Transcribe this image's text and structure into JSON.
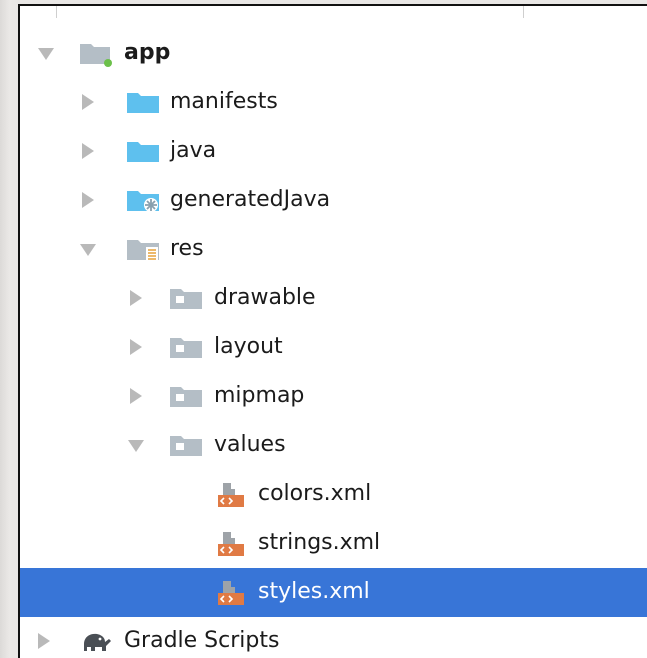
{
  "tree": {
    "app": {
      "label": "app",
      "expanded": true,
      "icon": "module-folder-icon"
    },
    "manifests": {
      "label": "manifests",
      "expanded": false,
      "icon": "folder-icon"
    },
    "java": {
      "label": "java",
      "expanded": false,
      "icon": "folder-icon"
    },
    "generatedJava": {
      "label": "generatedJava",
      "expanded": false,
      "icon": "generated-folder-icon"
    },
    "res": {
      "label": "res",
      "expanded": true,
      "icon": "resources-folder-icon"
    },
    "drawable": {
      "label": "drawable",
      "expanded": false,
      "icon": "resource-subfolder-icon"
    },
    "layout": {
      "label": "layout",
      "expanded": false,
      "icon": "resource-subfolder-icon"
    },
    "mipmap": {
      "label": "mipmap",
      "expanded": false,
      "icon": "resource-subfolder-icon"
    },
    "values": {
      "label": "values",
      "expanded": true,
      "icon": "resource-subfolder-icon"
    },
    "colors": {
      "label": "colors.xml",
      "icon": "xml-file-icon"
    },
    "strings": {
      "label": "strings.xml",
      "icon": "xml-file-icon"
    },
    "styles": {
      "label": "styles.xml",
      "icon": "xml-file-icon",
      "selected": true
    },
    "gradle": {
      "label": "Gradle Scripts",
      "expanded": false,
      "icon": "gradle-elephant-icon"
    }
  },
  "colors": {
    "selection": "#3875d7",
    "folder_blue": "#5ec0ee",
    "folder_gray": "#b4bec6",
    "xml_orange": "#e07a44"
  }
}
